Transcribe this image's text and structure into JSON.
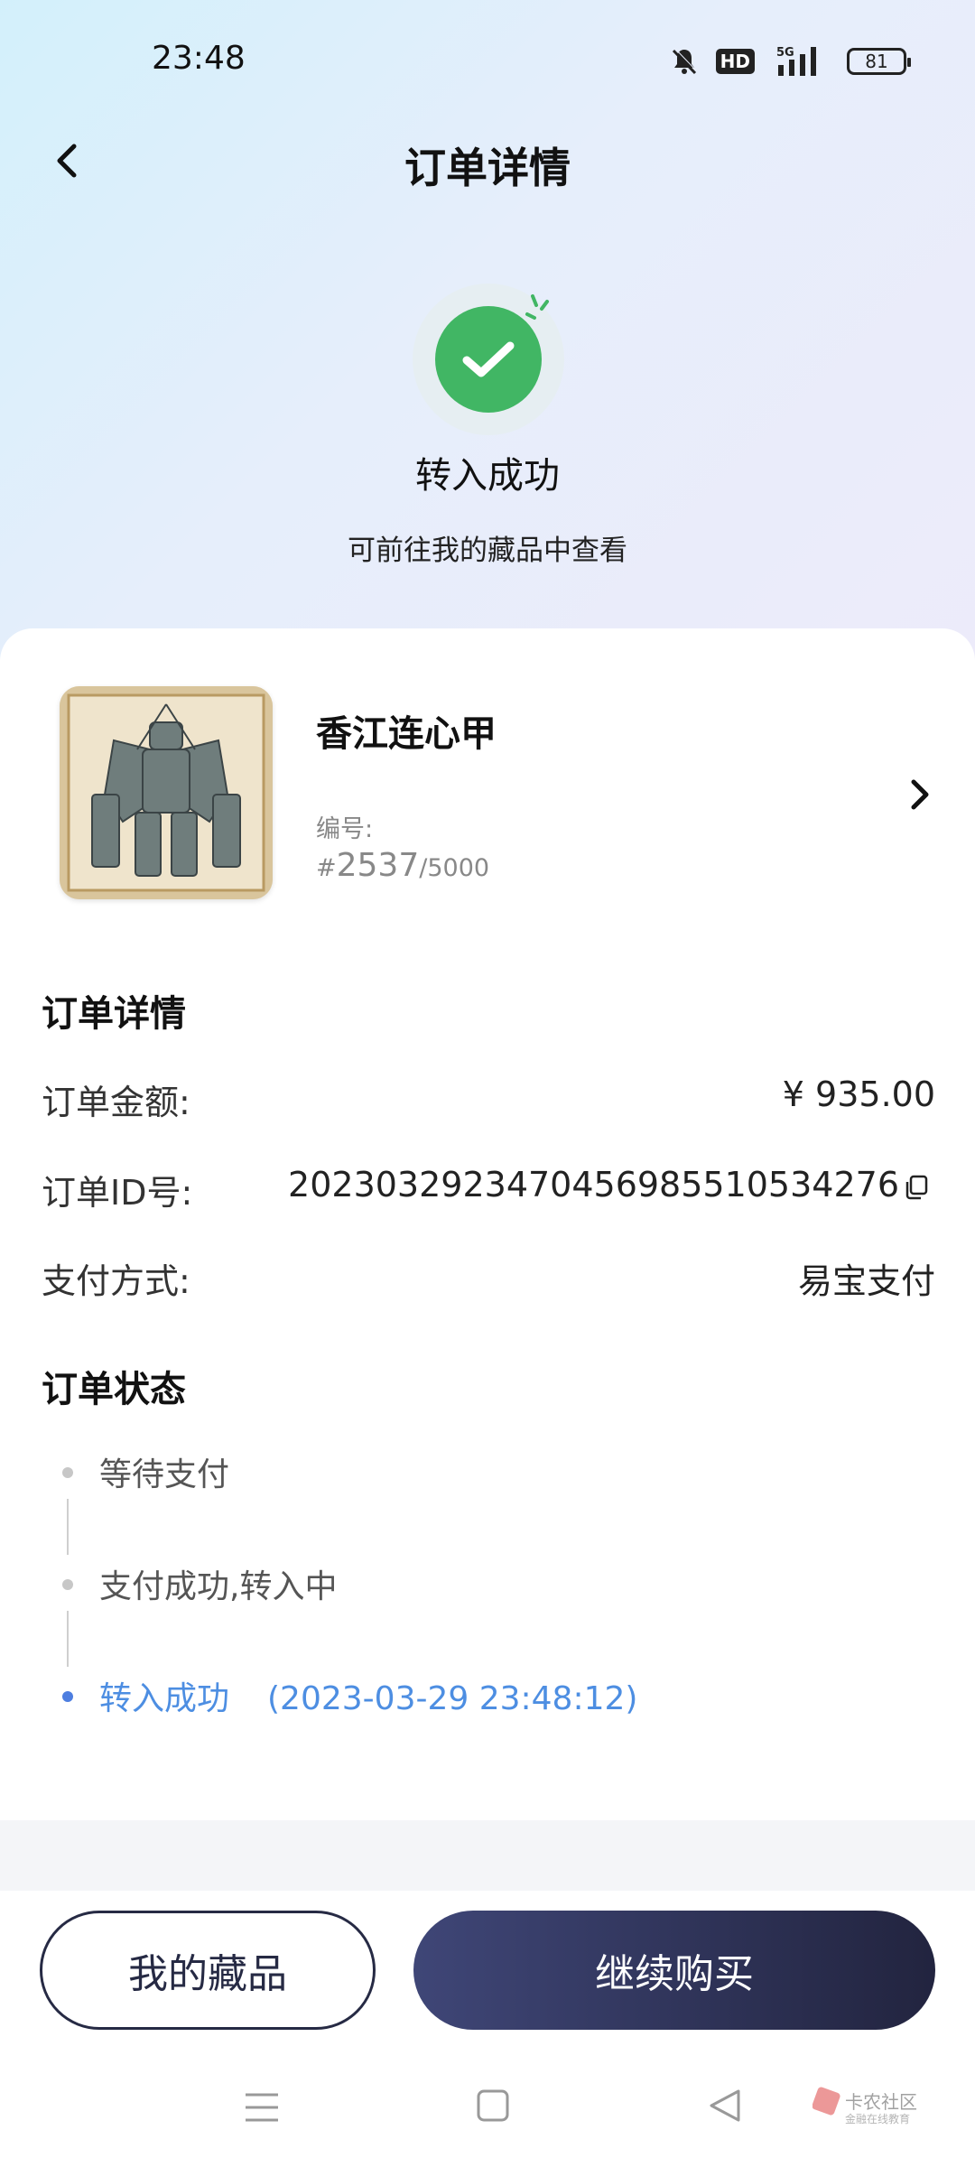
{
  "status_bar": {
    "time": "23:48",
    "hd_label": "HD",
    "network_label": "5G",
    "battery": "81"
  },
  "header": {
    "title": "订单详情",
    "back_icon": "chevron-left-icon"
  },
  "result": {
    "title": "转入成功",
    "subtitle": "可前往我的藏品中查看",
    "icon": "check-circle-icon",
    "color": "#41b664"
  },
  "product": {
    "name": "香江连心甲",
    "serial_label": "编号:",
    "serial_hash": "#",
    "serial_number": "2537",
    "serial_total": "/5000"
  },
  "order_details": {
    "title": "订单详情",
    "rows": [
      {
        "label": "订单金额:",
        "value": "¥ 935.00"
      },
      {
        "label": "订单ID号:",
        "value": "2023032923470456985510534276"
      },
      {
        "label": "支付方式:",
        "value": "易宝支付"
      }
    ]
  },
  "order_status": {
    "title": "订单状态",
    "steps": [
      {
        "label": "等待支付",
        "time": ""
      },
      {
        "label": "支付成功,转入中",
        "time": ""
      },
      {
        "label": "转入成功",
        "time": "(2023-03-29 23:48:12)"
      }
    ],
    "active_color": "#4d8ee2"
  },
  "actions": {
    "my_collection": "我的藏品",
    "continue_buy": "继续购买"
  },
  "watermark": {
    "text": "卡农社区",
    "sub": "金融在线教育"
  }
}
